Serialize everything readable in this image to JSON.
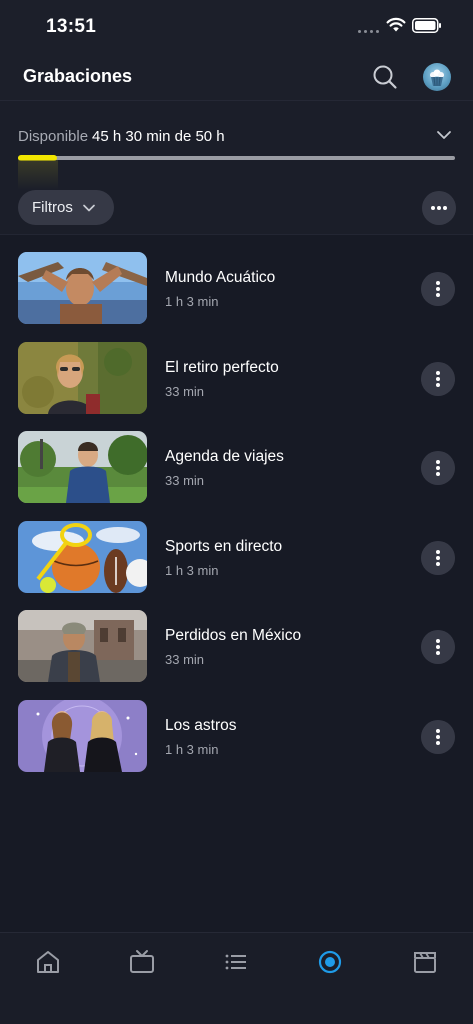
{
  "status_bar": {
    "time": "13:51"
  },
  "header": {
    "title": "Grabaciones",
    "search_icon": "search-icon",
    "avatar_icon": "cupcake-avatar"
  },
  "storage": {
    "label": "Disponible",
    "value": "45 h 30 min de 50 h",
    "used_fraction": 0.09,
    "accent_color": "#f2e600"
  },
  "filters": {
    "label": "Filtros"
  },
  "recordings": [
    {
      "title": "Mundo Acuático",
      "duration": "1 h 3 min"
    },
    {
      "title": "El retiro perfecto",
      "duration": "33 min"
    },
    {
      "title": "Agenda de viajes",
      "duration": "33 min"
    },
    {
      "title": "Sports en directo",
      "duration": "1 h 3 min"
    },
    {
      "title": "Perdidos en México",
      "duration": "33 min"
    },
    {
      "title": "Los astros",
      "duration": "1 h 3 min"
    }
  ],
  "tab_bar": {
    "tabs": [
      {
        "icon": "home-icon",
        "active": false
      },
      {
        "icon": "tv-icon",
        "active": false
      },
      {
        "icon": "list-icon",
        "active": false
      },
      {
        "icon": "record-icon",
        "active": true
      },
      {
        "icon": "clapperboard-icon",
        "active": false
      }
    ],
    "active_color": "#1f9be8",
    "inactive_color": "#9a9da6"
  }
}
